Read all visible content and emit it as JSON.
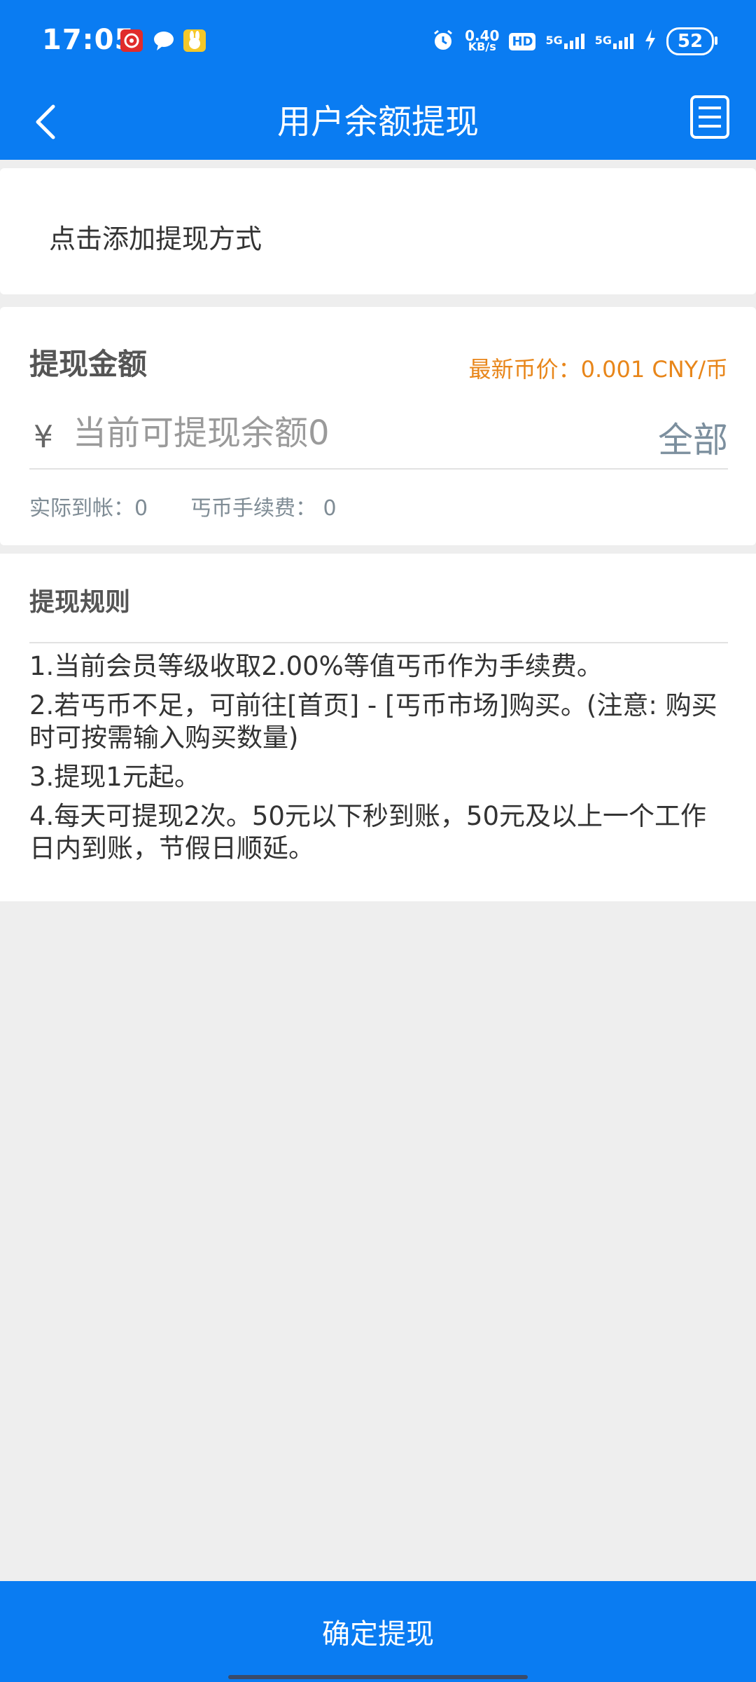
{
  "status_bar": {
    "time": "17:05",
    "network_speed_value": "0.40",
    "network_speed_unit": "KB/s",
    "signal1_label": "5G",
    "signal2_label": "5G",
    "hd_label": "HD",
    "battery_level": "52",
    "icons": [
      "netease-music-icon",
      "chat-bubble-icon",
      "app-rabbit-icon",
      "alarm-icon",
      "hd-icon",
      "signal-5g-icon",
      "signal-5g-icon",
      "charging-icon"
    ]
  },
  "header": {
    "title": "用户余额提现",
    "back_icon": "chevron-left-icon",
    "records_icon": "list-document-icon"
  },
  "add_method": {
    "label": "点击添加提现方式"
  },
  "amount": {
    "title": "提现金额",
    "price_label": "最新币价：0.001 CNY/币",
    "currency_symbol": "¥",
    "input_placeholder": "当前可提现余额0",
    "input_value": "",
    "all_button": "全部",
    "receipt": "实际到帐：0",
    "fee": "丐币手续费： 0"
  },
  "rules": {
    "title": "提现规则",
    "items": [
      "1.当前会员等级收取2.00%等值丐币作为手续费。",
      "2.若丐币不足，可前往[首页] - [丐币市场]购买。(注意: 购买时可按需输入购买数量)",
      "3.提现1元起。",
      "4.每天可提现2次。50元以下秒到账，50元及以上一个工作日内到账，节假日顺延。"
    ]
  },
  "footer": {
    "confirm_button": "确定提现"
  },
  "colors": {
    "primary": "#0a7cf2",
    "price": "#e8861a",
    "background": "#eeeeee"
  }
}
